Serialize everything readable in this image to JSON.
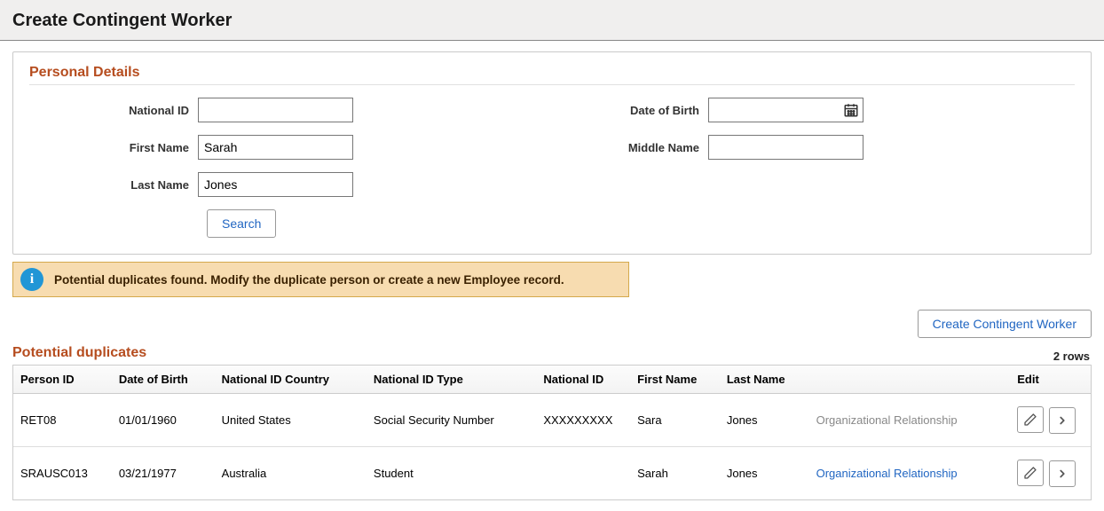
{
  "page_title": "Create Contingent Worker",
  "personal_details": {
    "title": "Personal Details",
    "fields": {
      "national_id": {
        "label": "National ID",
        "value": ""
      },
      "first_name": {
        "label": "First Name",
        "value": "Sarah"
      },
      "last_name": {
        "label": "Last Name",
        "value": "Jones"
      },
      "dob": {
        "label": "Date of Birth",
        "value": ""
      },
      "middle_name": {
        "label": "Middle Name",
        "value": ""
      }
    },
    "search_label": "Search"
  },
  "alert": {
    "text": "Potential duplicates found. Modify the duplicate person or create a new Employee record."
  },
  "action_button": "Create Contingent Worker",
  "duplicates": {
    "title": "Potential duplicates",
    "row_count_label": "2 rows",
    "columns": {
      "person_id": "Person ID",
      "dob": "Date of Birth",
      "nidc": "National ID Country",
      "nidt": "National ID Type",
      "nid": "National ID",
      "fn": "First Name",
      "ln": "Last Name",
      "edit": "Edit"
    },
    "org_link_label": "Organizational Relationship",
    "rows": [
      {
        "person_id": "RET08",
        "dob": "01/01/1960",
        "nidc": "United States",
        "nidt": "Social Security Number",
        "nid": "XXXXXXXXX",
        "fn": "Sara",
        "ln": "Jones",
        "org_active": false
      },
      {
        "person_id": "SRAUSC013",
        "dob": "03/21/1977",
        "nidc": "Australia",
        "nidt": "Student",
        "nid": "",
        "fn": "Sarah",
        "ln": "Jones",
        "org_active": true
      }
    ]
  }
}
